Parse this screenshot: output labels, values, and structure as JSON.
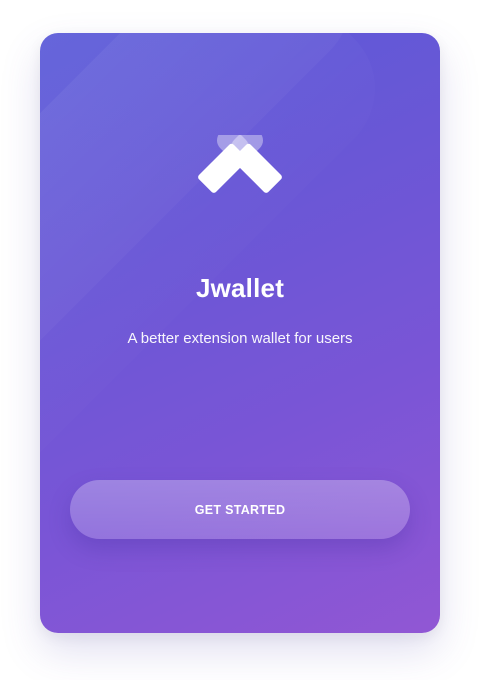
{
  "app": {
    "name": "Jwallet",
    "tagline": "A better extension wallet for users",
    "logo_icon": "jwallet-logo-icon"
  },
  "actions": {
    "get_started_label": "GET STARTED"
  },
  "colors": {
    "gradient_start": "#5a5ad8",
    "gradient_end": "#9157d4",
    "text": "#ffffff"
  }
}
